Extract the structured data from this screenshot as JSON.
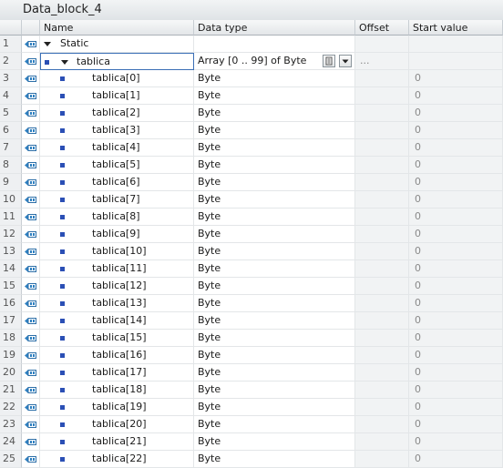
{
  "window": {
    "title": "Data_block_4"
  },
  "columns": {
    "name": "Name",
    "data_type": "Data type",
    "offset": "Offset",
    "start_value": "Start value"
  },
  "icons": {
    "row_icon": "db-element-icon",
    "expand": "triangle-down-icon",
    "bullet": "bullet-icon"
  },
  "rows": [
    {
      "num": "1",
      "name": "Static",
      "type": "",
      "offset": "",
      "start": "",
      "level": 0,
      "expander": true,
      "bullet": false
    },
    {
      "num": "2",
      "name": "tablica",
      "type": "Array [0 .. 99] of Byte",
      "offset": "...",
      "start": "",
      "level": 1,
      "expander": true,
      "bullet": true,
      "selected": true
    },
    {
      "num": "3",
      "name": "tablica[0]",
      "type": "Byte",
      "offset": "",
      "start": "0",
      "level": 2
    },
    {
      "num": "4",
      "name": "tablica[1]",
      "type": "Byte",
      "offset": "",
      "start": "0",
      "level": 2
    },
    {
      "num": "5",
      "name": "tablica[2]",
      "type": "Byte",
      "offset": "",
      "start": "0",
      "level": 2
    },
    {
      "num": "6",
      "name": "tablica[3]",
      "type": "Byte",
      "offset": "",
      "start": "0",
      "level": 2
    },
    {
      "num": "7",
      "name": "tablica[4]",
      "type": "Byte",
      "offset": "",
      "start": "0",
      "level": 2
    },
    {
      "num": "8",
      "name": "tablica[5]",
      "type": "Byte",
      "offset": "",
      "start": "0",
      "level": 2
    },
    {
      "num": "9",
      "name": "tablica[6]",
      "type": "Byte",
      "offset": "",
      "start": "0",
      "level": 2
    },
    {
      "num": "10",
      "name": "tablica[7]",
      "type": "Byte",
      "offset": "",
      "start": "0",
      "level": 2
    },
    {
      "num": "11",
      "name": "tablica[8]",
      "type": "Byte",
      "offset": "",
      "start": "0",
      "level": 2
    },
    {
      "num": "12",
      "name": "tablica[9]",
      "type": "Byte",
      "offset": "",
      "start": "0",
      "level": 2
    },
    {
      "num": "13",
      "name": "tablica[10]",
      "type": "Byte",
      "offset": "",
      "start": "0",
      "level": 2
    },
    {
      "num": "14",
      "name": "tablica[11]",
      "type": "Byte",
      "offset": "",
      "start": "0",
      "level": 2
    },
    {
      "num": "15",
      "name": "tablica[12]",
      "type": "Byte",
      "offset": "",
      "start": "0",
      "level": 2
    },
    {
      "num": "16",
      "name": "tablica[13]",
      "type": "Byte",
      "offset": "",
      "start": "0",
      "level": 2
    },
    {
      "num": "17",
      "name": "tablica[14]",
      "type": "Byte",
      "offset": "",
      "start": "0",
      "level": 2
    },
    {
      "num": "18",
      "name": "tablica[15]",
      "type": "Byte",
      "offset": "",
      "start": "0",
      "level": 2
    },
    {
      "num": "19",
      "name": "tablica[16]",
      "type": "Byte",
      "offset": "",
      "start": "0",
      "level": 2
    },
    {
      "num": "20",
      "name": "tablica[17]",
      "type": "Byte",
      "offset": "",
      "start": "0",
      "level": 2
    },
    {
      "num": "21",
      "name": "tablica[18]",
      "type": "Byte",
      "offset": "",
      "start": "0",
      "level": 2
    },
    {
      "num": "22",
      "name": "tablica[19]",
      "type": "Byte",
      "offset": "",
      "start": "0",
      "level": 2
    },
    {
      "num": "23",
      "name": "tablica[20]",
      "type": "Byte",
      "offset": "",
      "start": "0",
      "level": 2
    },
    {
      "num": "24",
      "name": "tablica[21]",
      "type": "Byte",
      "offset": "",
      "start": "0",
      "level": 2
    },
    {
      "num": "25",
      "name": "tablica[22]",
      "type": "Byte",
      "offset": "",
      "start": "0",
      "level": 2
    }
  ]
}
